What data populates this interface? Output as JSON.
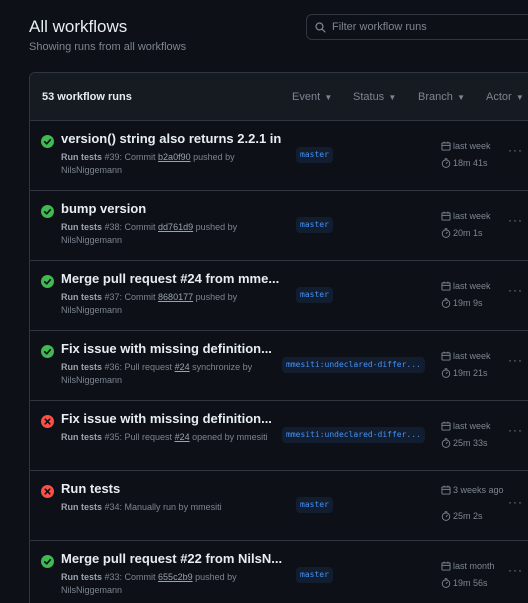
{
  "header": {
    "title": "All workflows",
    "subtitle": "Showing runs from all workflows"
  },
  "filter": {
    "placeholder": "Filter workflow runs"
  },
  "list": {
    "count_label": "53 workflow runs",
    "filters": [
      "Event",
      "Status",
      "Branch",
      "Actor"
    ]
  },
  "runs": [
    {
      "status": "success",
      "title": "version() string also returns 2.2.1 in",
      "workflow": "Run tests",
      "meta_pre": " #39: Commit ",
      "link": "b2a0f90",
      "meta_post": " pushed by NilsNiggemann",
      "branch": "master",
      "date": "last week",
      "duration": "18m 41s"
    },
    {
      "status": "success",
      "title": "bump version",
      "workflow": "Run tests",
      "meta_pre": " #38: Commit ",
      "link": "dd761d9",
      "meta_post": " pushed by NilsNiggemann",
      "branch": "master",
      "date": "last week",
      "duration": "20m 1s"
    },
    {
      "status": "success",
      "title": "Merge pull request #24 from mme...",
      "workflow": "Run tests",
      "meta_pre": " #37: Commit ",
      "link": "8680177",
      "meta_post": " pushed by NilsNiggemann",
      "branch": "master",
      "date": "last week",
      "duration": "19m 9s"
    },
    {
      "status": "success",
      "title": "Fix issue with missing definition...",
      "workflow": "Run tests",
      "meta_pre": " #36: Pull request ",
      "link": "#24",
      "meta_post": " synchronize by NilsNiggemann",
      "branch": "mmesiti:undeclared-differ...",
      "date": "last week",
      "duration": "19m 21s"
    },
    {
      "status": "failure",
      "title": "Fix issue with missing definition...",
      "workflow": "Run tests",
      "meta_pre": " #35: Pull request ",
      "link": "#24",
      "meta_post": " opened by mmesiti",
      "branch": "mmesiti:undeclared-differ...",
      "date": "last week",
      "duration": "25m 33s"
    },
    {
      "status": "failure",
      "title": "Run tests",
      "workflow": "Run tests",
      "meta_pre": " #34: Manually run by mmesiti",
      "link": "",
      "meta_post": "",
      "branch": "master",
      "date": "3 weeks ago",
      "duration": "25m 2s"
    },
    {
      "status": "success",
      "title": "Merge pull request #22 from NilsN...",
      "workflow": "Run tests",
      "meta_pre": " #33: Commit ",
      "link": "655c2b9",
      "meta_post": " pushed by NilsNiggemann",
      "branch": "master",
      "date": "last month",
      "duration": "19m 56s"
    }
  ],
  "colors": {
    "success": "#3fb950",
    "failure": "#f85149",
    "branch_text": "#4493f8"
  },
  "icons": {
    "search": "search-icon",
    "success": "check-circle-icon",
    "failure": "x-circle-icon",
    "calendar": "calendar-icon",
    "stopwatch": "stopwatch-icon",
    "more": "kebab-horizontal-icon"
  }
}
